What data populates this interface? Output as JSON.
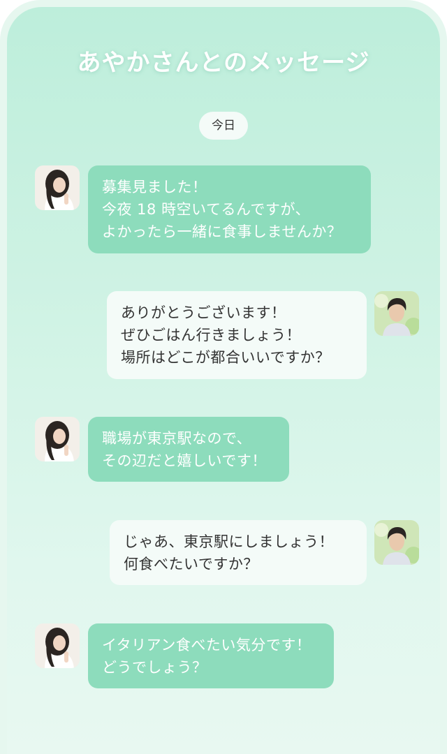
{
  "header": {
    "title": "あやかさんとのメッセージ"
  },
  "date_label": "今日",
  "contacts": {
    "her": {
      "avatar_icon": "woman-portrait-avatar"
    },
    "him": {
      "avatar_icon": "man-portrait-avatar"
    }
  },
  "colors": {
    "her_bubble": "#8ddcbc",
    "him_bubble": "#f4fbf8",
    "background": "#c8f0e0"
  },
  "messages": [
    {
      "sender": "her",
      "lines": [
        "募集見ました！",
        "今夜 18 時空いてるんですが、",
        "よかったら一緒に食事しませんか？"
      ]
    },
    {
      "sender": "him",
      "lines": [
        "ありがとうございます！",
        "ぜひごはん行きましょう！",
        "場所はどこが都合いいですか？"
      ]
    },
    {
      "sender": "her",
      "lines": [
        "職場が東京駅なので、",
        "その辺だと嬉しいです！"
      ]
    },
    {
      "sender": "him",
      "lines": [
        "じゃあ、東京駅にしましょう！",
        "何食べたいですか？"
      ]
    },
    {
      "sender": "her",
      "lines": [
        "イタリアン食べたい気分です！",
        "どうでしょう？"
      ]
    }
  ]
}
